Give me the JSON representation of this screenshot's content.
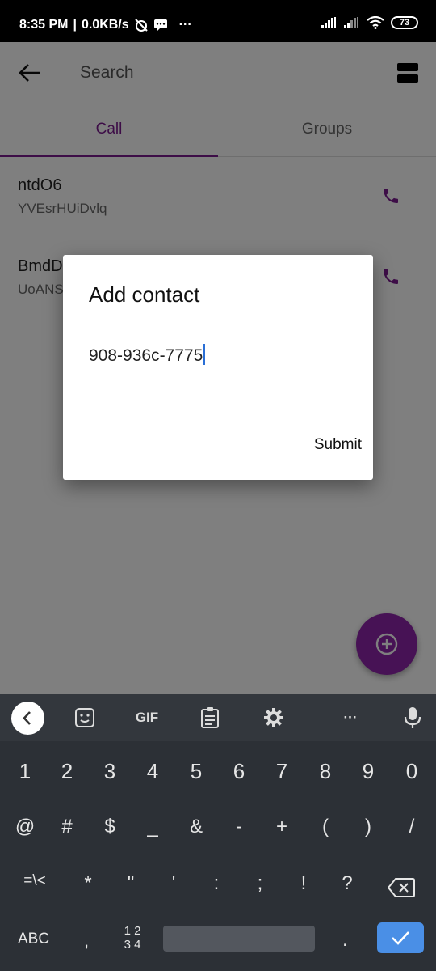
{
  "status_bar": {
    "time": "8:35 PM",
    "speed": "0.0KB/s",
    "more": "···",
    "battery": "73"
  },
  "toolbar": {
    "search_placeholder": "Search"
  },
  "tabs": [
    {
      "label": "Call"
    },
    {
      "label": "Groups"
    }
  ],
  "contacts": [
    {
      "name": "ntdO6",
      "sub": "YVEsrHUiDvlq"
    },
    {
      "name": "BmdD",
      "sub": "UoANS"
    }
  ],
  "dialog": {
    "title": "Add contact",
    "value": "908-936c-7775",
    "submit": "Submit"
  },
  "keyboard": {
    "toolbar": {
      "gif": "GIF",
      "more": "···"
    },
    "row1": [
      "1",
      "2",
      "3",
      "4",
      "5",
      "6",
      "7",
      "8",
      "9",
      "0"
    ],
    "row2": [
      "@",
      "#",
      "$",
      "_",
      "&",
      "-",
      "+",
      "(",
      ")",
      "/"
    ],
    "row3": [
      "=\\<",
      "*",
      "\"",
      "'",
      ":",
      ";",
      "!",
      "?"
    ],
    "bottom": {
      "abc": "ABC",
      "comma": ",",
      "numsw_top": "1 2",
      "numsw_bottom": "3 4",
      "period": "."
    }
  },
  "colors": {
    "accent": "#7a1a8e",
    "fab": "#8e24aa",
    "keyboard_bg": "#2c3036",
    "enter_key": "#4a8fe6"
  }
}
